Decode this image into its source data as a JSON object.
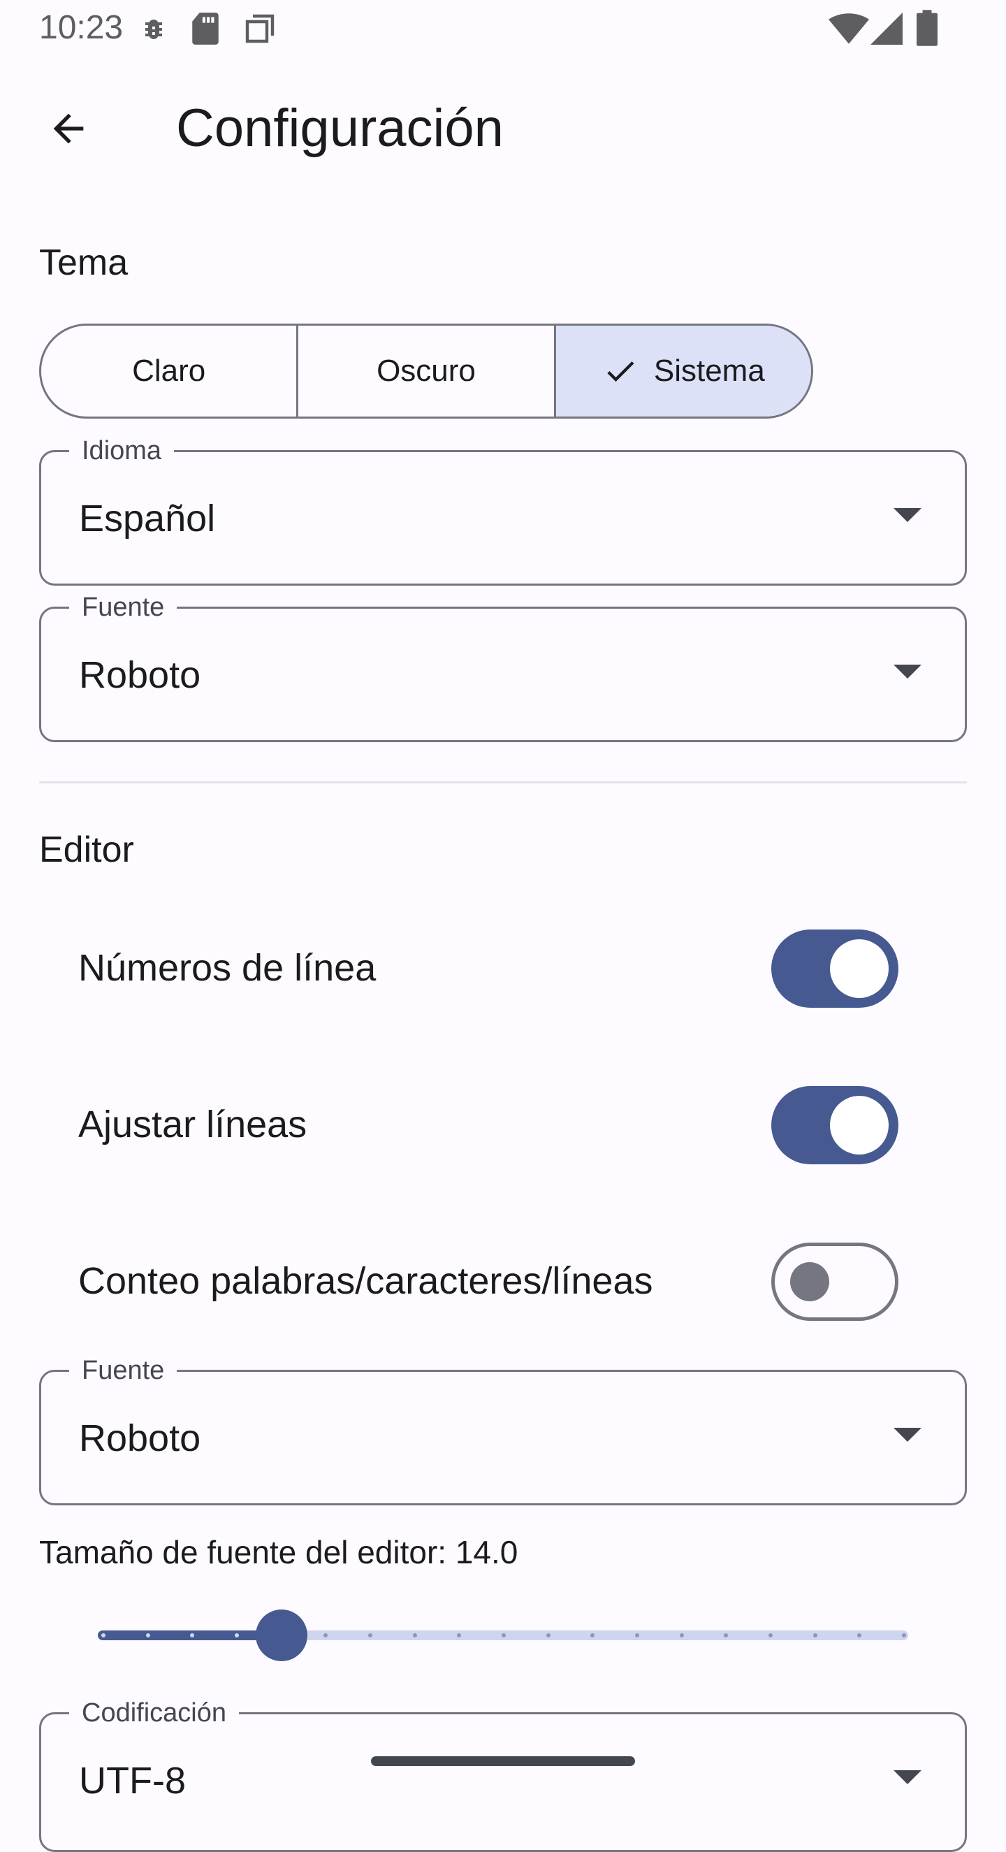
{
  "status_bar": {
    "time": "10:23"
  },
  "app_bar": {
    "title": "Configuración"
  },
  "theme": {
    "section_title": "Tema",
    "options": [
      "Claro",
      "Oscuro",
      "Sistema"
    ],
    "selected": "Sistema"
  },
  "language": {
    "label": "Idioma",
    "value": "Español"
  },
  "app_font": {
    "label": "Fuente",
    "value": "Roboto"
  },
  "editor": {
    "section_title": "Editor",
    "line_numbers": {
      "label": "Números de línea",
      "on": true
    },
    "wrap_lines": {
      "label": "Ajustar líneas",
      "on": true
    },
    "word_count": {
      "label": "Conteo palabras/caracteres/líneas",
      "on": false
    },
    "font": {
      "label": "Fuente",
      "value": "Roboto"
    },
    "font_size_label": "Tamaño de fuente del editor: 14.0",
    "font_size_fraction": 0.22
  },
  "encoding": {
    "label": "Codificación",
    "value": "UTF-8"
  },
  "colors": {
    "primary": "#465A91",
    "selected_segment": "#DCE1F7",
    "outline": "#767680",
    "background": "#FDFBFF"
  }
}
